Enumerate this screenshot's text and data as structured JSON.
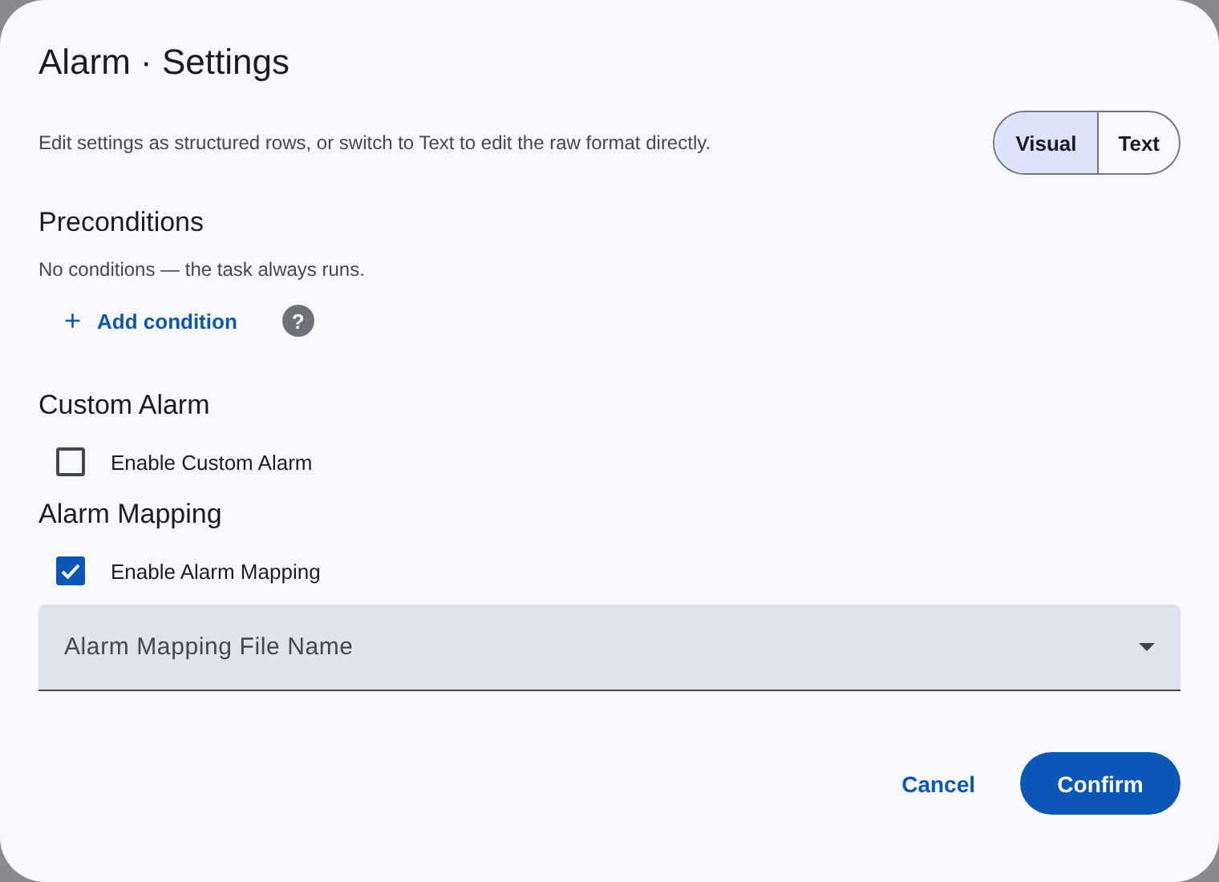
{
  "dialog": {
    "title": "Alarm · Settings",
    "description": "Edit settings as structured rows, or switch to Text to edit the raw format directly."
  },
  "mode_tabs": [
    {
      "label": "Visual",
      "selected": true
    },
    {
      "label": "Text",
      "selected": false
    }
  ],
  "sections": [
    {
      "heading": "Preconditions",
      "kind": "conditions",
      "note": "No conditions — the task always runs.",
      "add_icon": "+",
      "add_label": "Add condition",
      "help": "?"
    },
    {
      "heading": "Custom Alarm",
      "kind": "checkbox",
      "label": "Enable Custom Alarm",
      "checked": false
    },
    {
      "heading": "Alarm Mapping",
      "kind": "checkbox",
      "label": "Enable Alarm Mapping",
      "checked": true,
      "select": {
        "placeholder": "Alarm Mapping File Name"
      }
    }
  ],
  "buttons": [
    {
      "label": "Cancel",
      "kind": "text"
    },
    {
      "label": "Confirm",
      "kind": "primary"
    }
  ]
}
